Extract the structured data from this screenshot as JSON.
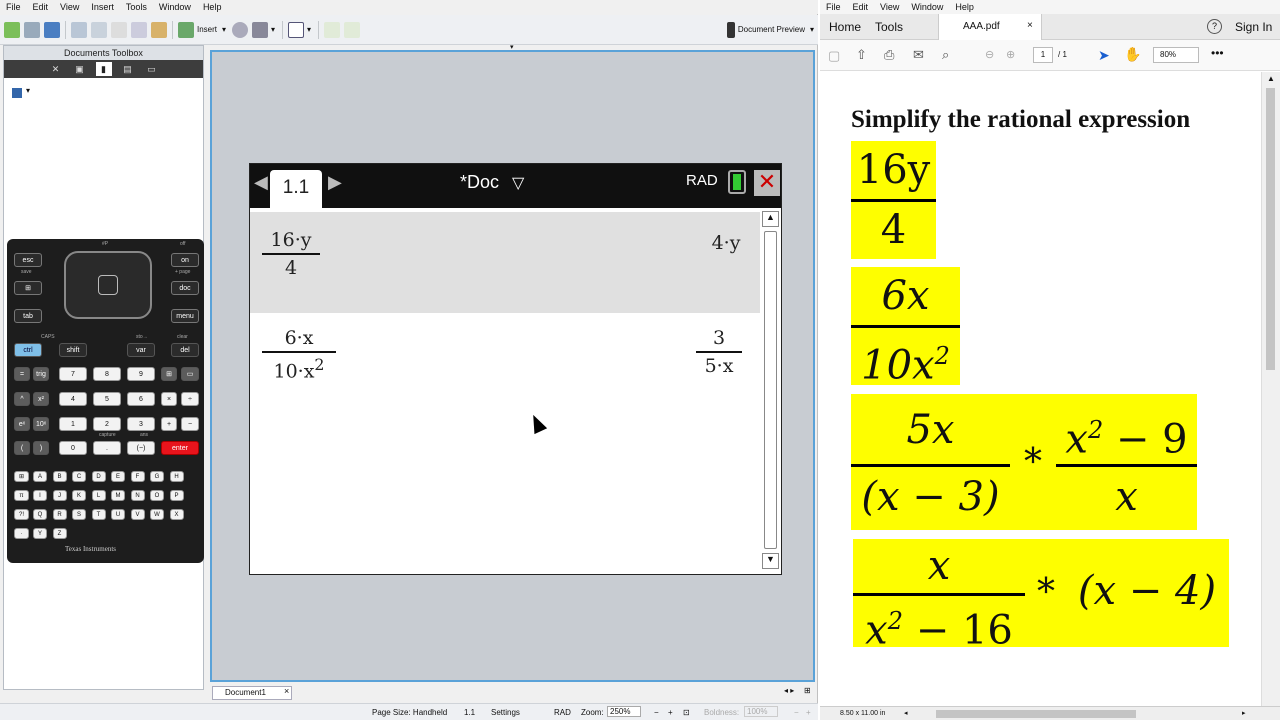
{
  "left_app": {
    "menu": [
      "File",
      "Edit",
      "View",
      "Insert",
      "Tools",
      "Window",
      "Help"
    ],
    "toolbar": {
      "insert_label": "Insert",
      "doc_preview_label": "Document Preview"
    },
    "toolbox": {
      "title": "Documents Toolbox"
    },
    "calculator": {
      "brand": "Texas Instruments",
      "keys": {
        "esc": "esc",
        "on": "on",
        "tab": "tab",
        "menu": "menu",
        "doc": "doc",
        "ctrl": "ctrl",
        "shift": "shift",
        "var": "var",
        "del": "del",
        "enter": "enter",
        "trig": "trig",
        "pi": "π",
        "ans": "ans",
        "neg": "(−)",
        "dot": ".",
        "zero": "0",
        "one": "1",
        "two": "2",
        "three": "3",
        "four": "4",
        "five": "5",
        "six": "6",
        "seven": "7",
        "eight": "8",
        "nine": "9",
        "plus": "+",
        "minus": "−",
        "times": "×",
        "divide": "÷",
        "eq": "=",
        "pow": "^",
        "sq": "x²",
        "ex": "eˣ",
        "tenx": "10ˣ",
        "lpar": "(",
        "rpar": ")"
      },
      "labels": {
        "save": "save",
        "off": "off",
        "page": "+ page",
        "caps": "CAPS",
        "sto": "sto→",
        "clear": "clear",
        "capture": "capture"
      },
      "letters": [
        "A",
        "B",
        "C",
        "D",
        "E",
        "F",
        "G",
        "H",
        "I",
        "J",
        "K",
        "L",
        "M",
        "N",
        "O",
        "P",
        "Q",
        "R",
        "S",
        "T",
        "U",
        "V",
        "W",
        "X",
        "Y",
        "Z"
      ]
    },
    "handheld": {
      "page_tab": "1.1",
      "doc_title": "*Doc",
      "angle_mode": "RAD",
      "entries": [
        {
          "num": "16·y",
          "den": "4",
          "result": "4·y"
        },
        {
          "num": "6·x",
          "den": "10·x",
          "den_exp": "2",
          "res_num": "3",
          "res_den": "5·x"
        }
      ]
    },
    "doc_tab": "Document1",
    "status": {
      "page_size": "Page Size: Handheld",
      "page": "1.1",
      "settings": "Settings",
      "mode": "RAD",
      "zoom_label": "Zoom:",
      "zoom_value": "250%",
      "boldness_label": "Boldness:",
      "boldness_value": "100%"
    }
  },
  "right_app": {
    "menu": [
      "File",
      "Edit",
      "View",
      "Window",
      "Help"
    ],
    "nav": {
      "home": "Home",
      "tools": "Tools",
      "file_tab": "AAA.pdf",
      "sign_in": "Sign In"
    },
    "tools": {
      "page_current": "1",
      "page_total": "/ 1",
      "zoom": "80%"
    },
    "pdf": {
      "heading": "Simplify the rational expression",
      "problems": [
        {
          "num": "16y",
          "den": "4"
        },
        {
          "num": "6x",
          "den": "10x",
          "den_exp": "2"
        },
        {
          "left_num": "5x",
          "left_den": "(x − 3)",
          "op": "*",
          "right_num": "x",
          "right_num_exp": "2",
          "right_num_tail": " − 9",
          "right_den": "x"
        },
        {
          "frac_num": "x",
          "frac_den": "x",
          "frac_den_exp": "2",
          "frac_den_tail": " − 16",
          "op": "*",
          "tail": "(x − 4)"
        }
      ]
    },
    "page_size_status": "8.50 x 11.00 in"
  },
  "colors": {
    "highlight": "#fefe00",
    "accent": "#5aa2d8",
    "close_red": "#cc0000",
    "enter_red": "#e8141c"
  }
}
